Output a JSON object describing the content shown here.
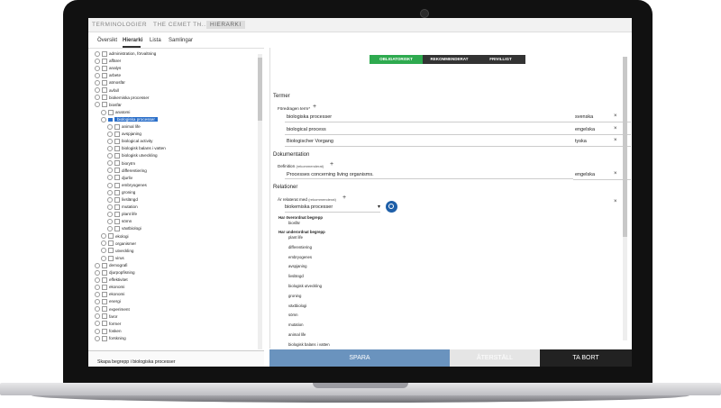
{
  "breadcrumb": [
    "TERMINOLOGIER",
    "THE CEMET TH...",
    "HIERARKI"
  ],
  "tabs": [
    "Översikt",
    "Hierarki",
    "Lista",
    "Samlingar"
  ],
  "tree": [
    "administration, förvaltning",
    "affärer",
    "analys",
    "arbete",
    "atmosfär",
    "avfall",
    "biokemiska processer",
    "biosfär",
    "anatomi",
    "biologiska processer",
    "animal life",
    "avspjaning",
    "biological activity",
    "biologisk balans i vatten",
    "biologisk utveckling",
    "biorytm",
    "differentiering",
    "djurliv",
    "embryogenes",
    "groning",
    "livslängd",
    "mutation",
    "plant life",
    "sömn",
    "växtbiologi",
    "ekologi",
    "organismer",
    "utveckling",
    "virus",
    "demografi",
    "djurpopfisning",
    "effektivitet",
    "ekonomi",
    "ekonomi",
    "energi",
    "experiment",
    "faror",
    "former",
    "fosken",
    "forskning"
  ],
  "create_label": "Skapa begrepp i biologiska processer",
  "segments": [
    "OBLIGATORISKT",
    "REKOMMENDERAT",
    "FRIVILLIGT"
  ],
  "termer": {
    "title": "Termer",
    "label": "Föredragen term",
    "rows": [
      {
        "term": "biologiska processer",
        "lang": "svenska"
      },
      {
        "term": "biological process",
        "lang": "engelska"
      },
      {
        "term": "Biologischer Vorgang",
        "lang": "tyska"
      }
    ]
  },
  "dokumentation": {
    "title": "Dokumentation",
    "label": "Definition",
    "hint": "(rekommenderat)",
    "text": "Processes concerning living organisms.",
    "lang": "engelska"
  },
  "relationer": {
    "title": "Relationer",
    "label": "Är relaterat med",
    "hint": "(rekommenderat)",
    "selected": "biokemiska processer",
    "overordnat_title": "Har överordnat begrepp",
    "overordnat": [
      "biosfär"
    ],
    "underordnat_title": "Har underordnat begrepp",
    "underordnat": [
      "plant life",
      "differentiering",
      "embryogenes",
      "avspjaning",
      "livslängd",
      "biologisk utveckling",
      "groning",
      "växtbiologi",
      "sömn",
      "mutation",
      "animal life",
      "biologisk balans i vatten"
    ]
  },
  "buttons": {
    "save": "SPARA",
    "reset": "ÅTERSTÄLL",
    "delete": "TA BORT"
  },
  "colors": {
    "green": "#2eaa4f",
    "dark": "#333333",
    "save": "#6a93be",
    "reset": "#e5e5e5",
    "delete": "#222222",
    "selected": "#2b6fc9"
  }
}
